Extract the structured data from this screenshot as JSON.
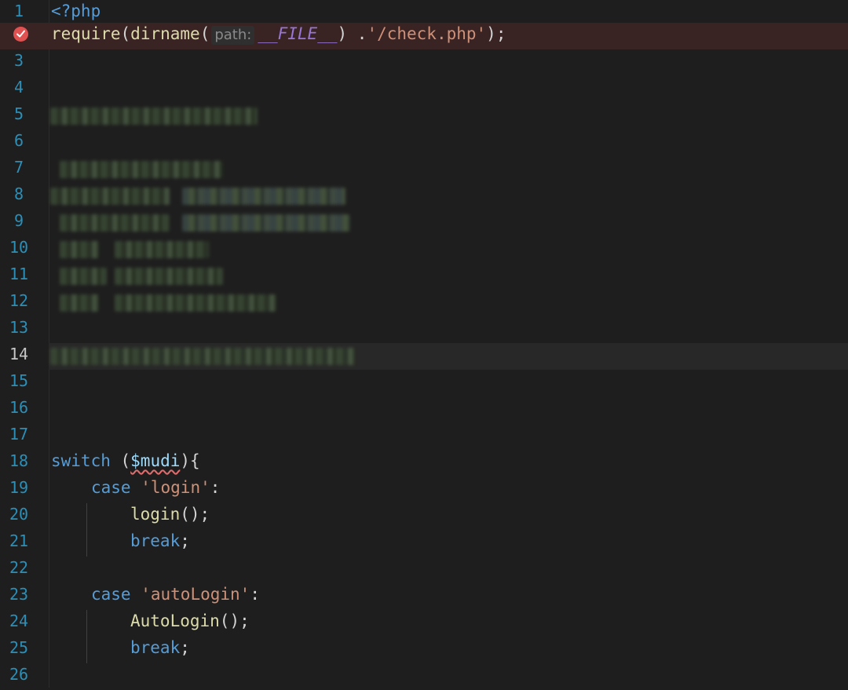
{
  "line_numbers": [
    "1",
    "2",
    "3",
    "4",
    "5",
    "6",
    "7",
    "8",
    "9",
    "10",
    "11",
    "12",
    "13",
    "14",
    "15",
    "16",
    "17",
    "18",
    "19",
    "20",
    "21",
    "22",
    "23",
    "24",
    "25",
    "26"
  ],
  "code": {
    "l1": {
      "open_tag": "<?php"
    },
    "l2": {
      "fn_require": "require",
      "paren_open": "(",
      "fn_dirname": "dirname",
      "paren_open2": "(",
      "hint": "path:",
      "const_file": "__FILE__",
      "paren_close": ")",
      "concat": " .",
      "str": "'/check.php'",
      "end": ");"
    },
    "l18": {
      "kw_switch": "switch",
      "paren_open": " (",
      "var": "$mudi",
      "paren_close": "){"
    },
    "l19": {
      "kw_case": "case",
      "str": "'login'",
      "colon": ":"
    },
    "l20": {
      "fn": "login",
      "end": "();"
    },
    "l21": {
      "kw_break": "break",
      "end": ";"
    },
    "l23": {
      "kw_case": "case",
      "str": "'autoLogin'",
      "colon": ":"
    },
    "l24": {
      "fn": "AutoLogin",
      "end": "();"
    },
    "l25": {
      "kw_break": "break",
      "end": ";"
    }
  },
  "breakpoint_line": "2",
  "current_line": "14",
  "icons": {
    "breakpoint": "breakpoint-check-icon"
  },
  "colors": {
    "background": "#1e1e1e",
    "line_number": "#2b8fb8",
    "keyword": "#569cd6",
    "function": "#dcdcaa",
    "string": "#ce9178",
    "constant": "#9876d6",
    "breakpoint": "#e05252"
  }
}
